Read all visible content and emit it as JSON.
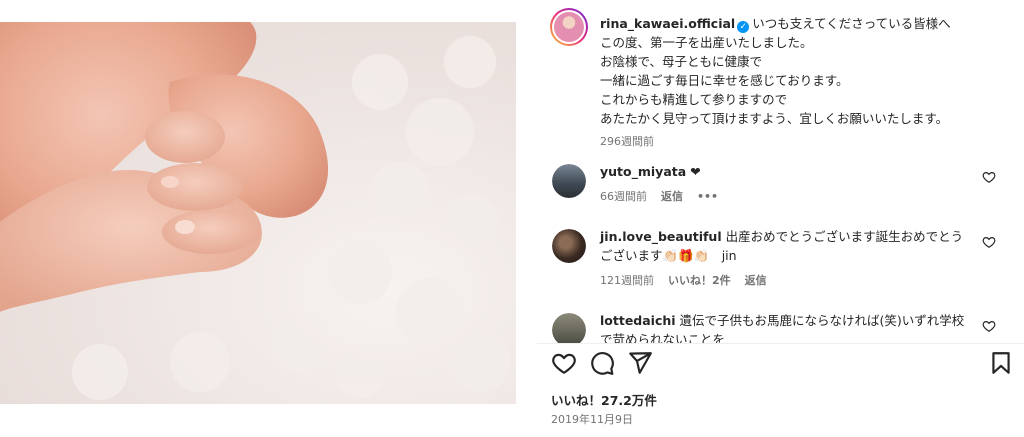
{
  "post": {
    "username": "rina_kawaei.official",
    "caption_lines": [
      "いつも支えてくださっている皆様へ",
      "この度、第一子を出産いたしました。",
      "お陰様で、母子ともに健康で",
      "一緒に過ごす毎日に幸せを感じております。",
      "これからも精進して参りますので",
      "あたたかく見守って頂けますよう、宜しくお願いいたします。"
    ],
    "caption_time": "296週間前"
  },
  "comments": [
    {
      "username": "yuto_miyata",
      "text": "❤",
      "time": "66週間前",
      "reply": "返信",
      "more": "•••"
    },
    {
      "username": "jin.love_beautiful",
      "text_line1": "出産おめでとうございます誕生おめでとう",
      "text_line2": "ございます👏🏻🎁👏🏻　jin",
      "time": "121週間前",
      "likes": "いいね！2件",
      "reply": "返信"
    },
    {
      "username": "lottedaichi",
      "text_line1": "遺伝で子供もお馬鹿にならなければ(笑)いずれ学校",
      "text_line2": "で苛められないことを"
    }
  ],
  "footer": {
    "likes": "いいね！27.2万件",
    "date": "2019年11月9日"
  },
  "icons": [
    "heart-icon",
    "comment-icon",
    "share-icon",
    "bookmark-icon",
    "verified-icon"
  ],
  "colors": {
    "verified": "#0095f6",
    "text": "#262626",
    "muted": "#737373"
  }
}
